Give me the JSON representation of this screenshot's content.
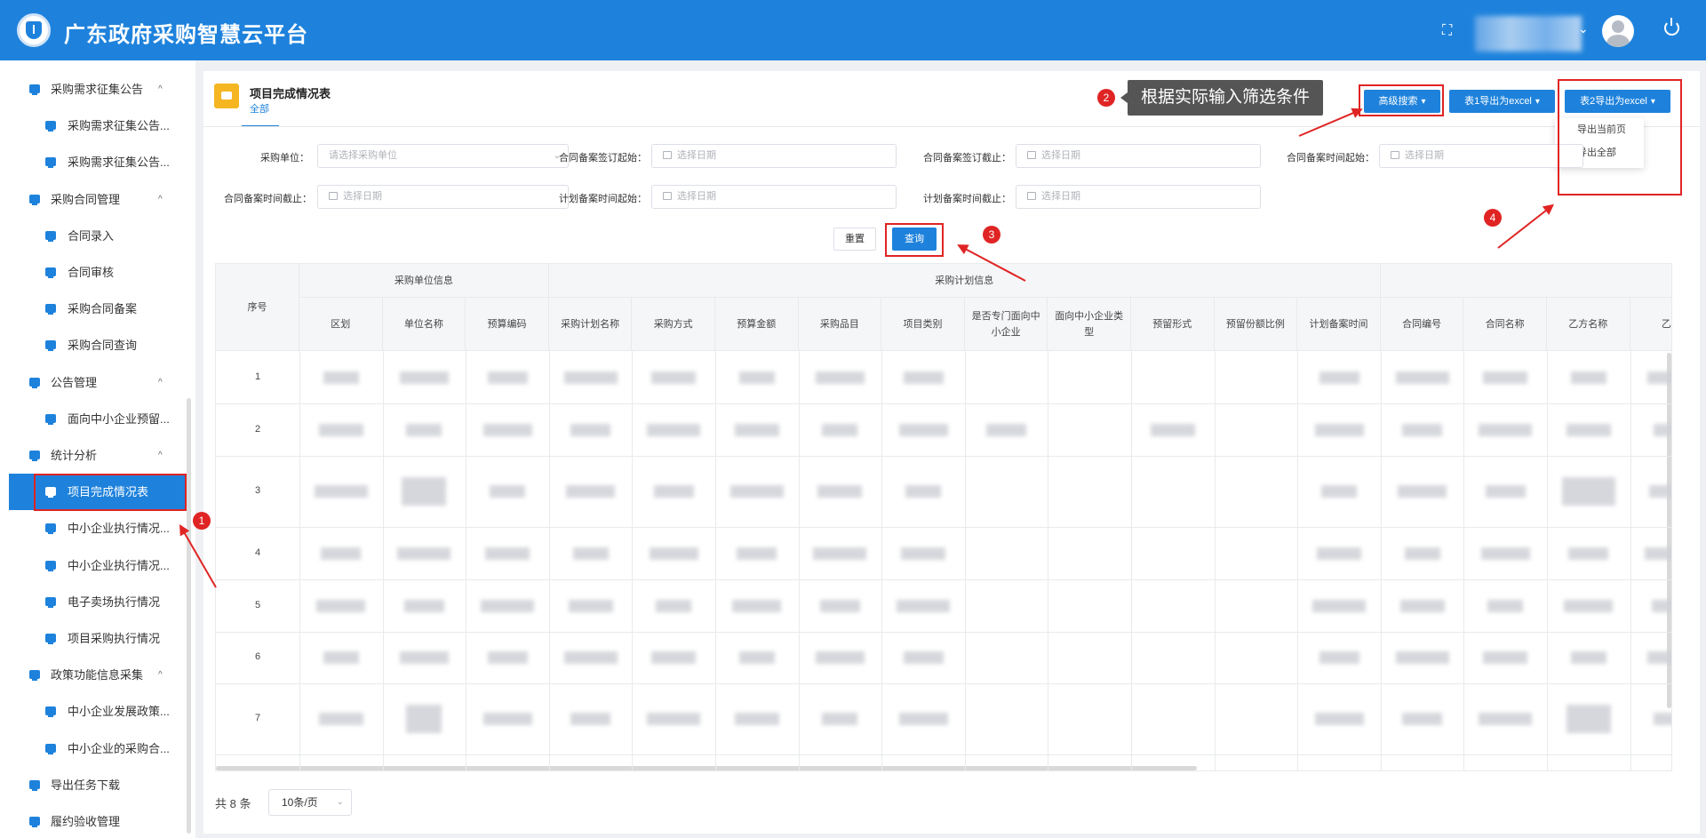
{
  "header": {
    "title": "广东政府采购智慧云平台"
  },
  "sidebar": {
    "items": [
      {
        "label": "采购需求征集公告",
        "level": 1,
        "caret": "^"
      },
      {
        "label": "采购需求征集公告...",
        "level": 2
      },
      {
        "label": "采购需求征集公告...",
        "level": 2
      },
      {
        "label": "采购合同管理",
        "level": 1,
        "caret": "^"
      },
      {
        "label": "合同录入",
        "level": 2
      },
      {
        "label": "合同审核",
        "level": 2
      },
      {
        "label": "采购合同备案",
        "level": 2
      },
      {
        "label": "采购合同查询",
        "level": 2
      },
      {
        "label": "公告管理",
        "level": 1,
        "caret": "^"
      },
      {
        "label": "面向中小企业预留...",
        "level": 2
      },
      {
        "label": "统计分析",
        "level": 1,
        "caret": "^"
      },
      {
        "label": "项目完成情况表",
        "level": 2,
        "active": true
      },
      {
        "label": "中小企业执行情况...",
        "level": 2
      },
      {
        "label": "中小企业执行情况...",
        "level": 2
      },
      {
        "label": "电子卖场执行情况",
        "level": 2
      },
      {
        "label": "项目采购执行情况",
        "level": 2
      },
      {
        "label": "政策功能信息采集",
        "level": 1,
        "caret": "^"
      },
      {
        "label": "中小企业发展政策...",
        "level": 2
      },
      {
        "label": "中小企业的采购合...",
        "level": 2
      },
      {
        "label": "导出任务下载",
        "level": 1
      },
      {
        "label": "履约验收管理",
        "level": 1
      }
    ]
  },
  "page": {
    "title": "项目完成情况表",
    "tab": "全部",
    "tooltip": "根据实际输入筛选条件",
    "buttons": {
      "advanced_search": "高级搜索",
      "export1": "表1导出为excel",
      "export2": "表2导出为excel",
      "reset": "重置",
      "query": "查询"
    },
    "dropdown": [
      "导出当前页",
      "导出全部"
    ]
  },
  "filters": {
    "purchase_unit": {
      "label": "采购单位：",
      "placeholder": "请选择采购单位"
    },
    "sign_start": {
      "label": "合同备案签订起始：",
      "placeholder": "选择日期"
    },
    "sign_end": {
      "label": "合同备案签订截止：",
      "placeholder": "选择日期"
    },
    "record_start": {
      "label": "合同备案时间起始：",
      "placeholder": "选择日期"
    },
    "record_end": {
      "label": "合同备案时间截止：",
      "placeholder": "选择日期"
    },
    "plan_start": {
      "label": "计划备案时间起始：",
      "placeholder": "选择日期"
    },
    "plan_end": {
      "label": "计划备案时间截止：",
      "placeholder": "选择日期"
    }
  },
  "table": {
    "group_headers": [
      "采购单位信息",
      "采购计划信息"
    ],
    "seq_header": "序号",
    "columns": [
      "区划",
      "单位名称",
      "预算编码",
      "采购计划名称",
      "采购方式",
      "预算金额",
      "采购品目",
      "项目类别",
      "是否专门面向中小企业",
      "面向中小企业类型",
      "预留形式",
      "预留份额比例",
      "计划备案时间",
      "合同编号",
      "合同名称",
      "乙方名称",
      "乙方"
    ],
    "rows": [
      "1",
      "2",
      "3",
      "4",
      "5",
      "6",
      "7"
    ]
  },
  "pagination": {
    "total": "共 8 条",
    "page_size": "10条/页"
  },
  "annotations": [
    "1",
    "2",
    "3",
    "4"
  ],
  "colors": {
    "primary": "#1e82dc",
    "annotation": "#e02424",
    "accent": "#f5b622"
  }
}
